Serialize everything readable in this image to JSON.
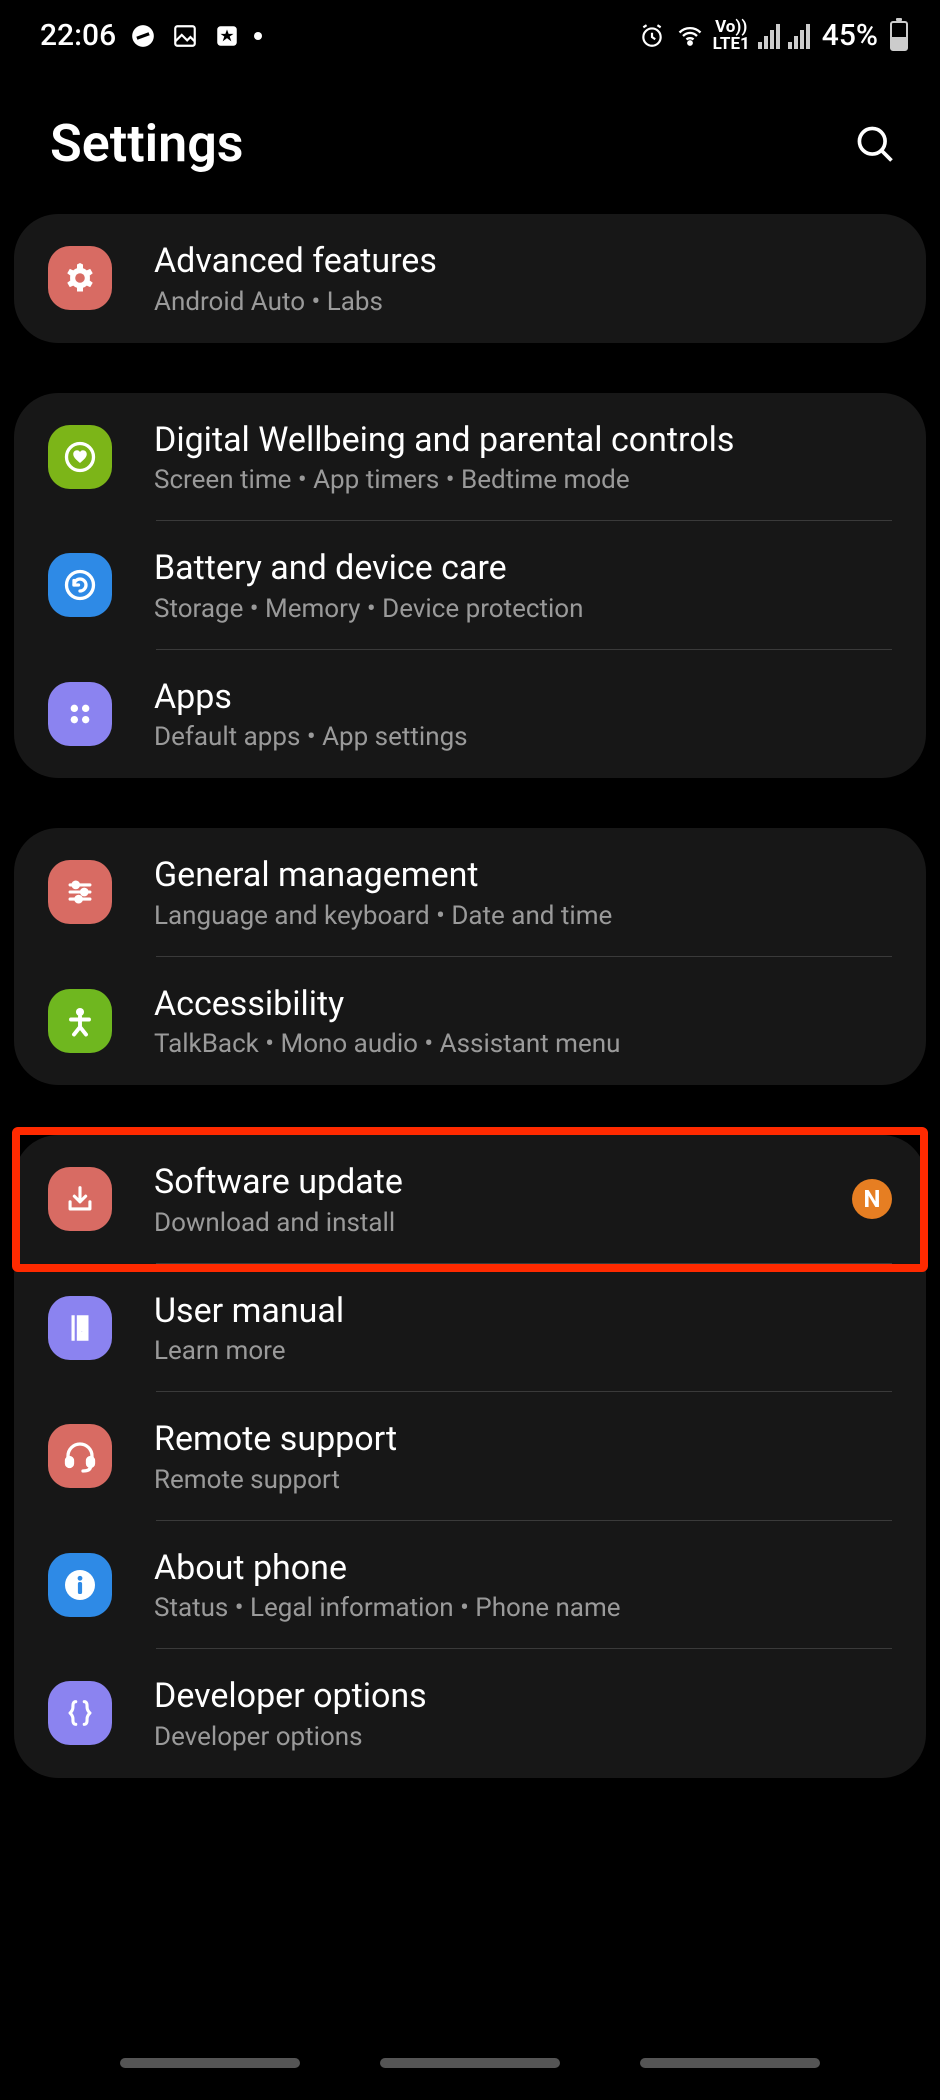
{
  "status": {
    "time": "22:06",
    "battery_pct": "45%",
    "lte_line1": "Vo))",
    "lte_line2": "LTE1"
  },
  "header": {
    "title": "Settings"
  },
  "groups": [
    {
      "items": [
        {
          "id": "advanced-features",
          "icon_color": "#d86b63",
          "icon": "gear-plus",
          "title": "Advanced features",
          "sub": "Android Auto  •  Labs"
        }
      ]
    },
    {
      "items": [
        {
          "id": "digital-wellbeing",
          "icon_color": "#7cb518",
          "icon": "heart-ring",
          "title": "Digital Wellbeing and parental controls",
          "sub": "Screen time  •  App timers  •  Bedtime mode"
        },
        {
          "id": "battery-care",
          "icon_color": "#2e8ae6",
          "icon": "refresh-ring",
          "title": "Battery and device care",
          "sub": "Storage  •  Memory  •  Device protection"
        },
        {
          "id": "apps",
          "icon_color": "#8b83f0",
          "icon": "four-dots",
          "title": "Apps",
          "sub": "Default apps  •  App settings"
        }
      ]
    },
    {
      "items": [
        {
          "id": "general-management",
          "icon_color": "#d86b63",
          "icon": "sliders",
          "title": "General management",
          "sub": "Language and keyboard  •  Date and time"
        },
        {
          "id": "accessibility",
          "icon_color": "#6fb71f",
          "icon": "person",
          "title": "Accessibility",
          "sub": "TalkBack  •  Mono audio  •  Assistant menu"
        }
      ]
    },
    {
      "items": [
        {
          "id": "software-update",
          "icon_color": "#d86b63",
          "icon": "download-arrow",
          "title": "Software update",
          "sub": "Download and install",
          "badge": "N",
          "highlighted": true
        },
        {
          "id": "user-manual",
          "icon_color": "#8b83f0",
          "icon": "book-question",
          "title": "User manual",
          "sub": "Learn more"
        },
        {
          "id": "remote-support",
          "icon_color": "#d86b63",
          "icon": "headset",
          "title": "Remote support",
          "sub": "Remote support"
        },
        {
          "id": "about-phone",
          "icon_color": "#2e8ae6",
          "icon": "info",
          "title": "About phone",
          "sub": "Status  •  Legal information  •  Phone name"
        },
        {
          "id": "developer-options",
          "icon_color": "#8b83f0",
          "icon": "braces",
          "title": "Developer options",
          "sub": "Developer options"
        }
      ]
    }
  ]
}
